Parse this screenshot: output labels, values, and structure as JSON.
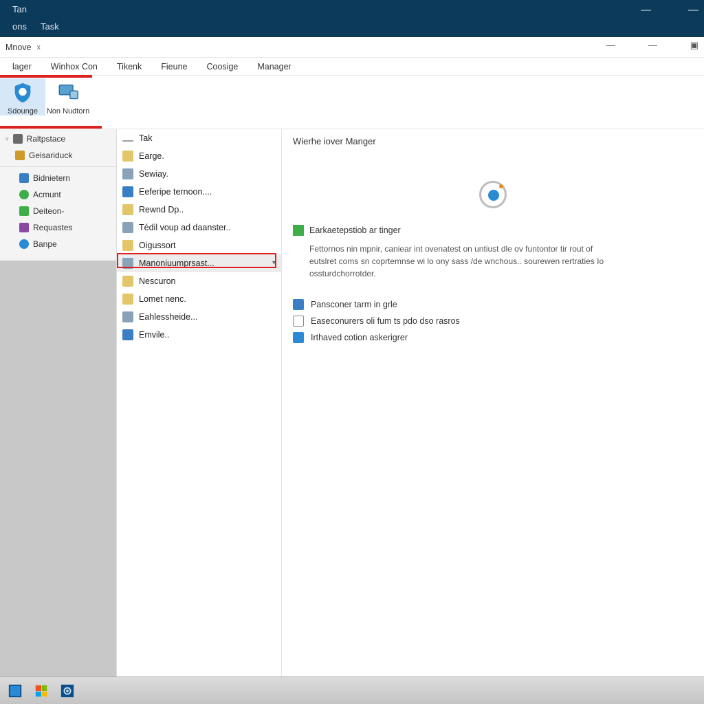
{
  "topbar": {
    "tabs": [
      "Tan",
      "ons",
      "Task"
    ],
    "wc": [
      "—",
      "—"
    ]
  },
  "chrome": {
    "tab": "Mnove",
    "close": "x",
    "wc": [
      "—",
      "—",
      "▣"
    ]
  },
  "menubar": [
    "lager",
    "Winhox Con",
    "Tikenk",
    "Fieune",
    "Coosige",
    "Manager"
  ],
  "ribbon": {
    "items": [
      {
        "label": "Sdounge"
      },
      {
        "label": "Non Nudtorn"
      }
    ]
  },
  "leftnav": {
    "root": [
      {
        "label": "Raltpstace",
        "color": "#6a6a6a"
      },
      {
        "label": "Geisariduck",
        "color": "#d09a2a"
      }
    ],
    "items": [
      {
        "label": "Bidnietern",
        "color": "#3a7fc4"
      },
      {
        "label": "Acmunt",
        "color": "#3fae49"
      },
      {
        "label": "Deiteon-",
        "color": "#3fae49"
      },
      {
        "label": "Requastes",
        "color": "#8a4aa3"
      },
      {
        "label": "Banpe",
        "color": "#2a8ad4"
      }
    ]
  },
  "menu": {
    "items": [
      {
        "label": "Tak",
        "ic": "#9aa0a6"
      },
      {
        "label": "Earge.",
        "ic": "#e3c56a"
      },
      {
        "label": "Sewiay.",
        "ic": "#8aa2b8"
      },
      {
        "label": "Eeferipe ternoon....",
        "ic": "#3a7fc4"
      },
      {
        "label": "Rewnd Dp..",
        "ic": "#e3c56a"
      },
      {
        "label": "Tédil voup ad daanster..",
        "ic": "#8aa2b8"
      },
      {
        "label": "Oigussort",
        "ic": "#e3c56a"
      },
      {
        "label": "Manoniuumprsast...",
        "ic": "#8aa2b8",
        "sel": true,
        "chev": true
      },
      {
        "label": "Nescuron",
        "ic": "#e3c56a"
      },
      {
        "label": "Lomet nenc.",
        "ic": "#e3c56a"
      },
      {
        "label": "Eahlessheide...",
        "ic": "#8aa2b8"
      },
      {
        "label": "Emvile..",
        "ic": "#3a7fc4"
      }
    ]
  },
  "content": {
    "title": "Wierhe iover Manger",
    "h2": "Earkaetepstiob ar tinger",
    "desc": "Fettornos nin mpnir, caniear int ovenatest on untiust dle ov funtontor tir rout of eutslret coms sn coprtemnse wi lo ony sass /de wnchous.. sourewen rertraties Io ossturdchorrotder.",
    "links": [
      {
        "label": "Pansconer tarm in grle",
        "color": "#3a7fc4"
      },
      {
        "label": "Easeconurers oli fum ts pdo dso rasros",
        "color": "#6a6a6a"
      },
      {
        "label": "Irthaved cotion askerigrer",
        "color": "#2a8ad4"
      }
    ]
  },
  "taskbar": {
    "items": [
      "windows",
      "store",
      "settings"
    ]
  }
}
